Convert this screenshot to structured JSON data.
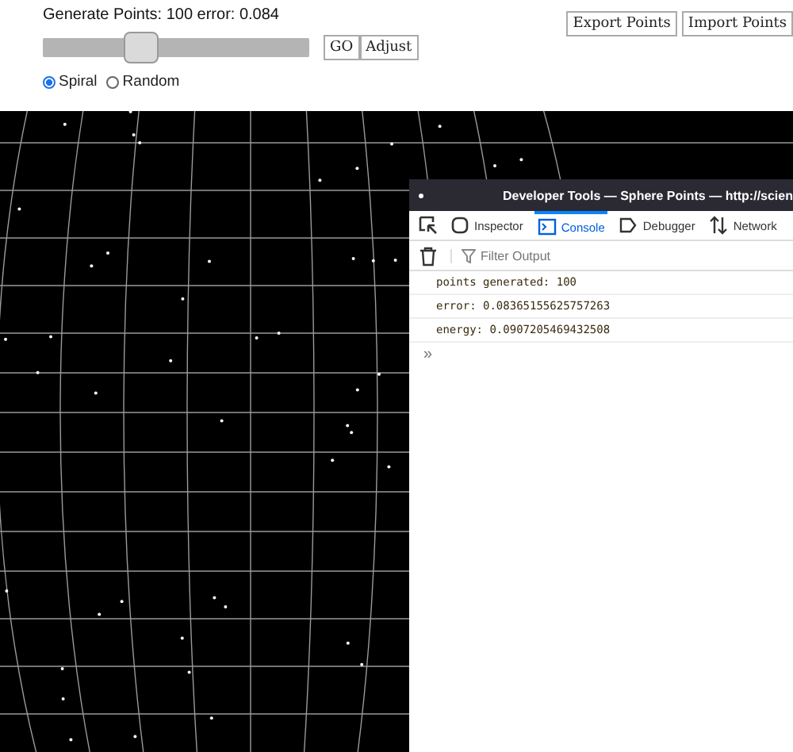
{
  "header": {
    "status": "Generate Points: 100 error: 0.084"
  },
  "export_buttons": [
    "Export Points",
    "Import Points"
  ],
  "slider": {
    "level": 0.33
  },
  "action_buttons": [
    "GO",
    "Adjust"
  ],
  "modes": [
    {
      "label": "Spiral",
      "selected": true
    },
    {
      "label": "Random",
      "selected": false
    }
  ],
  "devtools": {
    "title": "Developer Tools — Sphere Points — http://scien",
    "tabs": [
      {
        "label": "Inspector",
        "selected": false,
        "kind": "inspector"
      },
      {
        "label": "Console",
        "selected": true,
        "kind": "console"
      },
      {
        "label": "Debugger",
        "selected": false,
        "kind": "debugger"
      },
      {
        "label": "Network",
        "selected": false,
        "kind": "network"
      }
    ],
    "filter": {
      "placeholder": "Filter Output"
    },
    "console_lines": [
      "points generated: 100",
      "error: 0.08365155625757263",
      "energy: 0.0907205469432508"
    ],
    "prompt": "»"
  }
}
